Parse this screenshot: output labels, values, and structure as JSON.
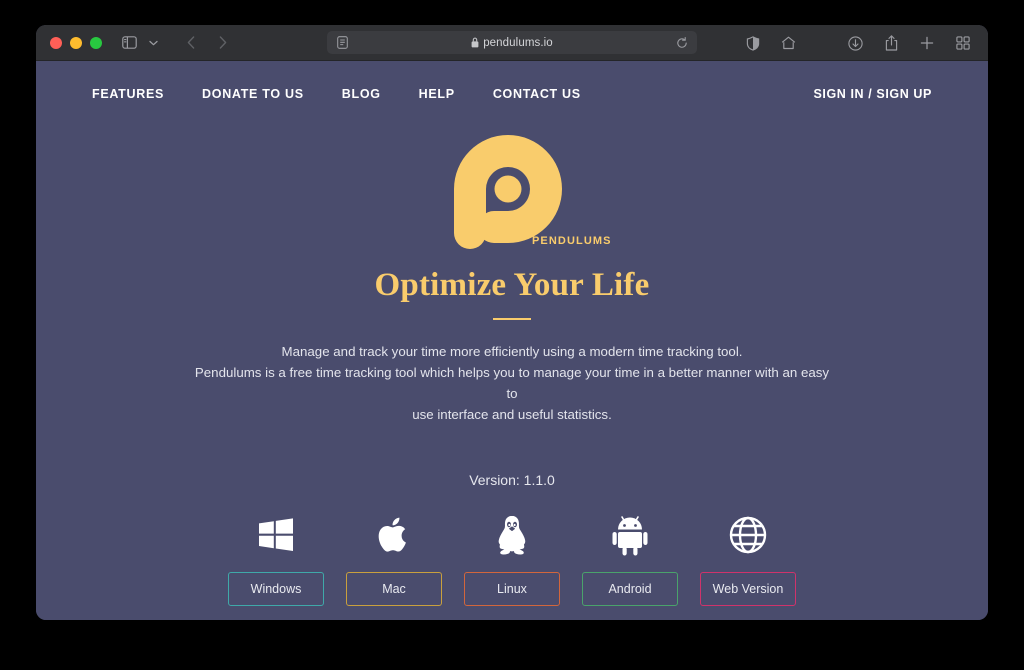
{
  "browser": {
    "url": "pendulums.io",
    "lock_icon": "lock-icon",
    "reader_icon": "reader-view-icon",
    "reload_icon": "reload-icon",
    "sidebar_icon": "sidebar-toggle-icon",
    "chevron_icon": "chevron-down-icon",
    "back_icon": "back-arrow-icon",
    "forward_icon": "forward-arrow-icon",
    "contrast_icon": "contrast-icon",
    "home_icon": "home-icon",
    "downloads_icon": "downloads-icon",
    "share_icon": "share-icon",
    "newtab_icon": "plus-icon",
    "taboverview_icon": "tab-overview-icon",
    "traffic_lights": {
      "close": "#ff5f57",
      "minimize": "#febc2e",
      "zoom": "#28c840"
    }
  },
  "site": {
    "nav": [
      {
        "label": "FEATURES"
      },
      {
        "label": "DONATE TO US"
      },
      {
        "label": "BLOG"
      },
      {
        "label": "HELP"
      },
      {
        "label": "CONTACT US"
      }
    ],
    "auth_label": "SIGN IN / SIGN UP",
    "logo": {
      "icon": "pendulums-logo-icon",
      "brand": "PENDULUMS",
      "color": "#f9cc6c"
    },
    "hero": {
      "headline": "Optimize Your Life",
      "description_line_1": "Manage and track your time more efficiently using a modern time tracking tool.",
      "description_line_2": "Pendulums is a free time tracking tool which helps you to manage your time in a better manner with an easy to",
      "description_line_3": "use interface and useful statistics."
    },
    "version_label": "Version: 1.1.0",
    "downloads": [
      {
        "label": "Windows",
        "icon": "windows-icon",
        "border_color": "#3fa9a9"
      },
      {
        "label": "Mac",
        "icon": "apple-icon",
        "border_color": "#c9a03d"
      },
      {
        "label": "Linux",
        "icon": "linux-icon",
        "border_color": "#d2663c"
      },
      {
        "label": "Android",
        "icon": "android-icon",
        "border_color": "#4aa36b"
      },
      {
        "label": "Web Version",
        "icon": "globe-icon",
        "border_color": "#d0336b"
      }
    ],
    "colors": {
      "background": "#4a4c6d",
      "accent": "#f9cc6c",
      "text": "#e6e7ee"
    }
  }
}
